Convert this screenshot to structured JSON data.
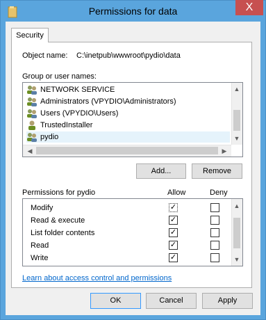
{
  "window": {
    "title": "Permissions for data",
    "close_label": "X",
    "folder_color": "#e8c36a",
    "accent_color": "#5aa5dd",
    "close_color": "#c75050"
  },
  "tabs": [
    {
      "label": "Security"
    }
  ],
  "object": {
    "label": "Object name:",
    "value": "C:\\inetpub\\wwwroot\\pydio\\data"
  },
  "groups": {
    "label": "Group or user names:",
    "items": [
      {
        "name": "NETWORK SERVICE",
        "icon": "users-icon"
      },
      {
        "name": "Administrators (VPYDIO\\Administrators)",
        "icon": "users-icon"
      },
      {
        "name": "Users (VPYDIO\\Users)",
        "icon": "users-icon"
      },
      {
        "name": "TrustedInstaller",
        "icon": "user-icon"
      },
      {
        "name": "pydio",
        "icon": "users-icon",
        "selected": true
      }
    ]
  },
  "buttons": {
    "add": "Add...",
    "remove": "Remove",
    "ok": "OK",
    "cancel": "Cancel",
    "apply": "Apply"
  },
  "permissions": {
    "label": "Permissions for pydio",
    "allow_header": "Allow",
    "deny_header": "Deny",
    "rows": [
      {
        "name": "Modify",
        "allow": true,
        "deny": false
      },
      {
        "name": "Read & execute",
        "allow": true,
        "deny": false
      },
      {
        "name": "List folder contents",
        "allow": true,
        "deny": false
      },
      {
        "name": "Read",
        "allow": true,
        "deny": false
      },
      {
        "name": "Write",
        "allow": true,
        "deny": false
      }
    ]
  },
  "link": {
    "label": "Learn about access control and permissions"
  }
}
